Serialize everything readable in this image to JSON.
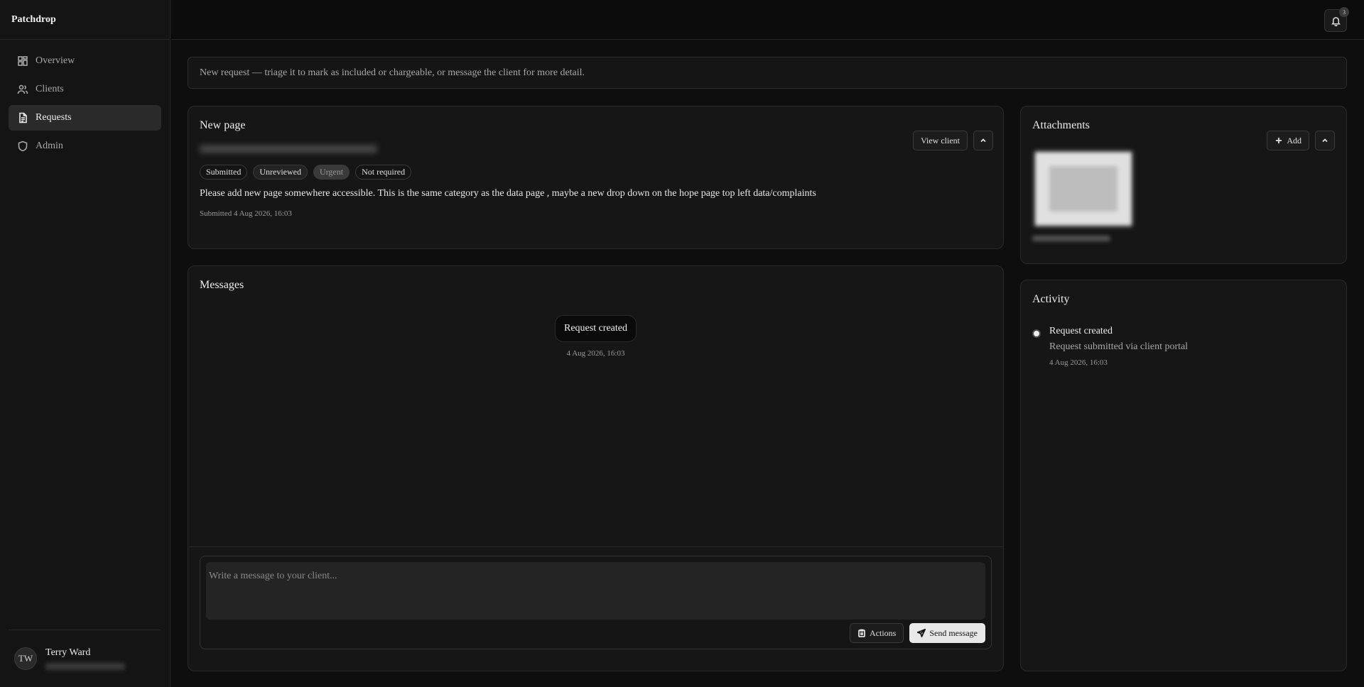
{
  "app": {
    "name": "Patchdrop"
  },
  "sidebar": {
    "items": [
      {
        "label": "Overview",
        "icon": "grid-icon",
        "active": false
      },
      {
        "label": "Clients",
        "icon": "users-icon",
        "active": false
      },
      {
        "label": "Requests",
        "icon": "file-icon",
        "active": true
      },
      {
        "label": "Admin",
        "icon": "shield-icon",
        "active": false
      }
    ],
    "user": {
      "initials": "TW",
      "name": "Terry Ward"
    }
  },
  "topbar": {
    "notification_count": "3"
  },
  "banner": {
    "text": "New request — triage it to mark as included or chargeable, or message the client for more detail."
  },
  "request": {
    "title": "New page",
    "view_client_label": "View client",
    "badges": [
      "Submitted",
      "Unreviewed",
      "Urgent",
      "Not required"
    ],
    "description": "Please add new page somewhere accessible. This is the same category as the data page , maybe a new drop down on the hope page top left data/complaints",
    "submitted": "Submitted 4 Aug 2026, 16:03"
  },
  "messages": {
    "title": "Messages",
    "items": [
      {
        "text": "Request created",
        "time": "4 Aug 2026, 16:03"
      }
    ],
    "composer": {
      "placeholder": "Write a message to your client...",
      "actions_label": "Actions",
      "send_label": "Send message"
    }
  },
  "attachments": {
    "title": "Attachments",
    "add_label": "Add"
  },
  "activity": {
    "title": "Activity",
    "items": [
      {
        "title": "Request created",
        "subtitle": "Request submitted via client portal",
        "time": "4 Aug 2026, 16:03"
      }
    ]
  }
}
